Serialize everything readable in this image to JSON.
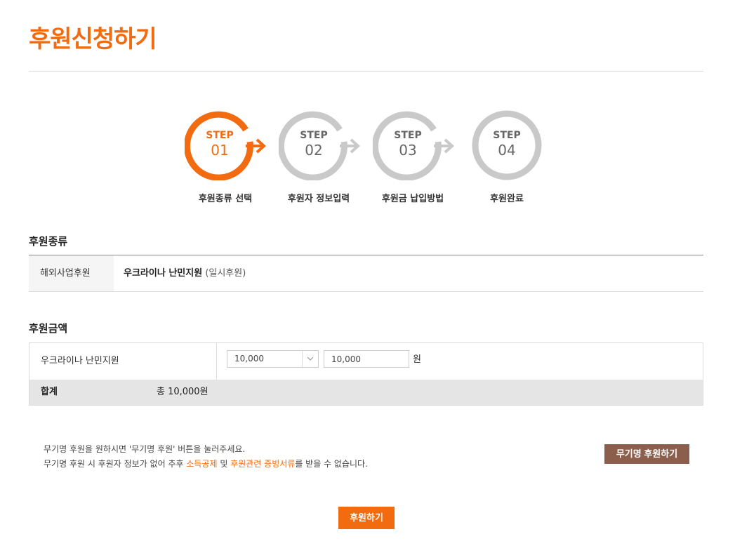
{
  "page": {
    "title": "후원신청하기"
  },
  "steps": [
    {
      "word": "STEP",
      "num": "01",
      "caption": "후원종류 선택"
    },
    {
      "word": "STEP",
      "num": "02",
      "caption": "후원자 정보입력"
    },
    {
      "word": "STEP",
      "num": "03",
      "caption": "후원금 납입방법"
    },
    {
      "word": "STEP",
      "num": "04",
      "caption": "후원완료"
    }
  ],
  "colors": {
    "accent": "#f26b10",
    "inactive": "#c9c9c9",
    "anon_button": "#8c5f4c"
  },
  "donation_type": {
    "section_title": "후원종류",
    "label": "해외사업후원",
    "value": "우크라이나 난민지원",
    "note": "(일시후원)"
  },
  "donation_amount": {
    "section_title": "후원금액",
    "item_label": "우크라이나 난민지원",
    "select_value": "10,000",
    "input_value": "10,000",
    "unit": "원",
    "total_label": "합계",
    "total_value": "총 10,000원"
  },
  "notice": {
    "line1": "무기명 후원을 원하시면 '무기명 후원' 버튼을 눌러주세요.",
    "line2_pre": "무기명 후원 시 후원자 정보가 없어 추후 ",
    "line2_hl1": "소득공제",
    "line2_mid": " 및 ",
    "line2_hl2": "후원관련 증빙서류",
    "line2_post": "를 받을 수 없습니다."
  },
  "buttons": {
    "anonymous": "무기명 후원하기",
    "submit": "후원하기"
  }
}
